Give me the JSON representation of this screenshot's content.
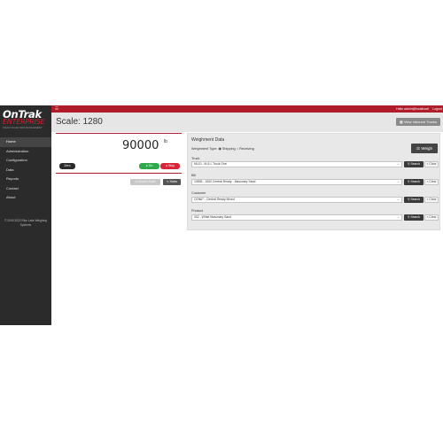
{
  "sidebar": {
    "logo_main": "OnTrak",
    "logo_sub": "ENTERPRISE",
    "logo_tag": "TRUCK SCALE DATA MANAGEMENT",
    "items": [
      {
        "label": "Home"
      },
      {
        "label": "Administration"
      },
      {
        "label": "Configuration"
      },
      {
        "label": "Data"
      },
      {
        "label": "Reports"
      },
      {
        "label": "Contact"
      },
      {
        "label": "About"
      }
    ],
    "copyright": "© 2000-2022 Rice Lake Weighing Systems"
  },
  "topbar": {
    "menu_icon": "hamburger-menu-icon",
    "greeting": "Hello admin@localhost!",
    "logout_label": "Logout"
  },
  "header": {
    "title": "Scale: 1280",
    "inbound_label": "View Inbound Trucks"
  },
  "scale": {
    "weight": "90000",
    "unit": "lb",
    "zero_label": "Zero",
    "go_label": "Go",
    "stop_label": "Stop",
    "disable_label": "Disable Scale",
    "notes_label": "Notes"
  },
  "weighment": {
    "title": "Weighment Data",
    "type_label": "Weighment Type:",
    "shipping_label": "Shipping",
    "receiving_label": "Receiving",
    "weigh_label": "Weigh",
    "fields": [
      {
        "label": "Truck",
        "value": "ML10 - M & L Truck One"
      },
      {
        "label": "Bill",
        "value": "10835 - 1500 Central Ready - Masonary Sand"
      },
      {
        "label": "Customer",
        "value": "CEN67 - Central Ready Mixed"
      },
      {
        "label": "Product",
        "value": "002 - White Masonary Sand"
      }
    ],
    "search_label": "Search",
    "clear_label": "Clear"
  },
  "colors": {
    "brand_red": "#b11c2b",
    "sidebar_bg": "#2b2b2b",
    "go_green": "#2eaa4a",
    "stop_red": "#d8253a"
  }
}
